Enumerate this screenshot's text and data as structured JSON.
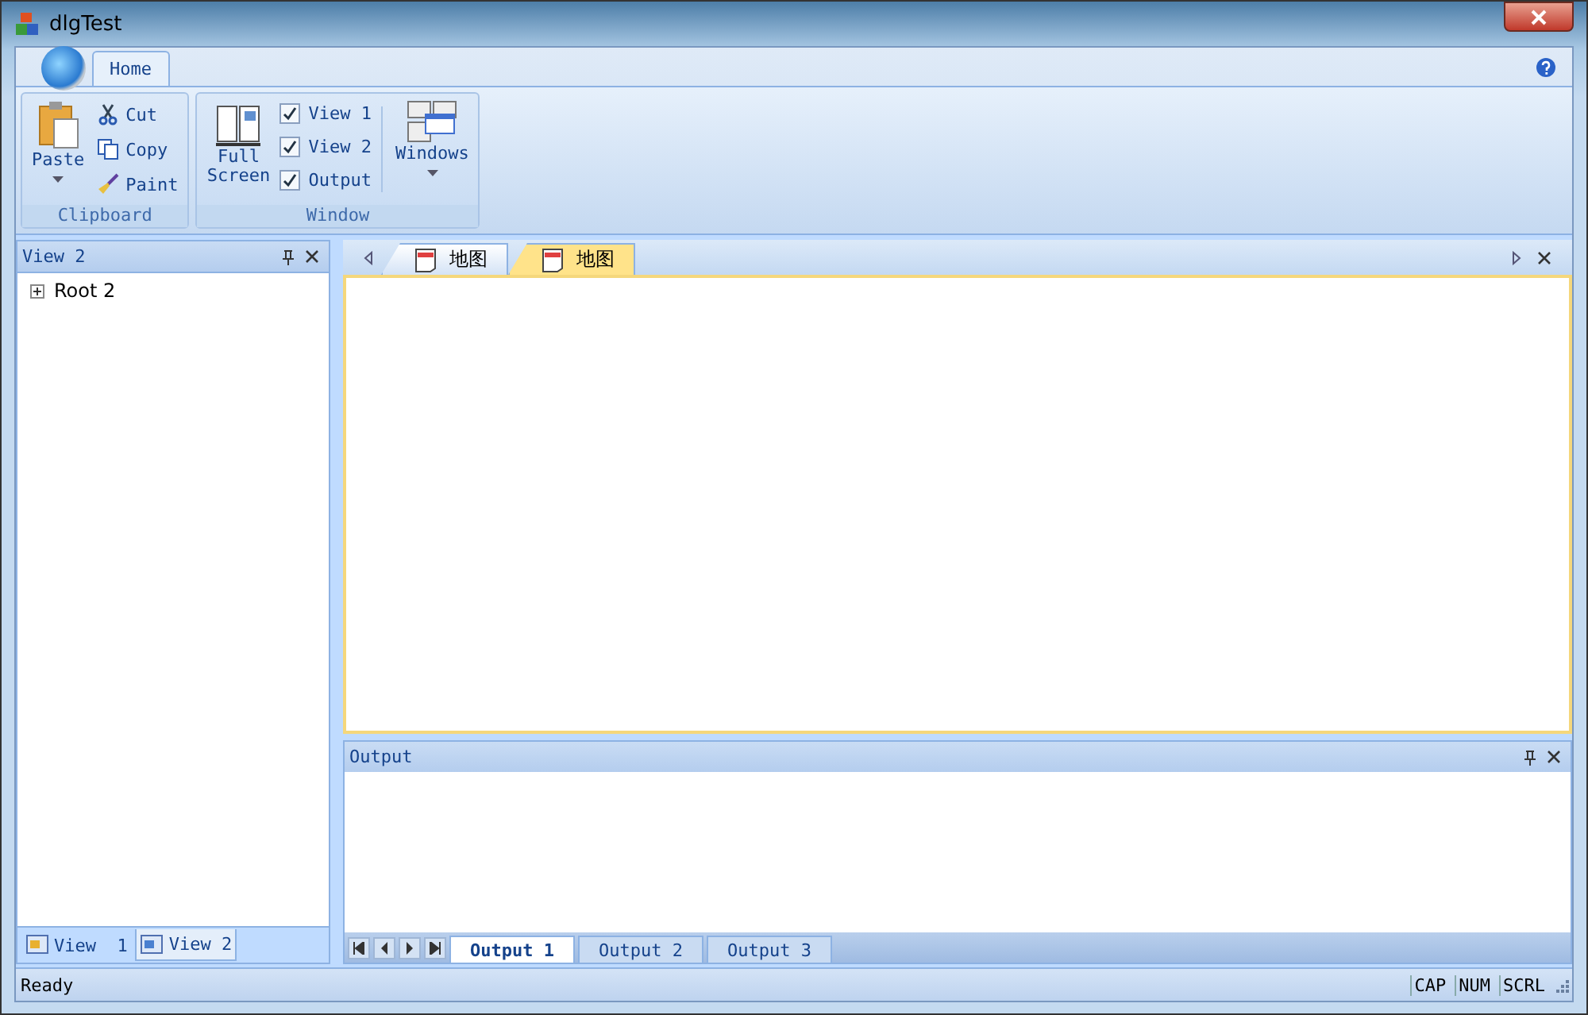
{
  "window": {
    "title": "dlgTest"
  },
  "ribbon": {
    "tabs": [
      {
        "label": "Home",
        "selected": true
      }
    ],
    "clipboard": {
      "label": "Clipboard",
      "paste": "Paste",
      "small": [
        {
          "kind": "cut",
          "label": "Cut"
        },
        {
          "kind": "copy",
          "label": "Copy"
        },
        {
          "kind": "paint",
          "label": "Paint"
        }
      ]
    },
    "window_group": {
      "label": "Window",
      "full_screen": "Full Screen",
      "checks": [
        {
          "label": "View 1",
          "checked": true
        },
        {
          "label": "View 2",
          "checked": true
        },
        {
          "label": "Output",
          "checked": true
        }
      ],
      "windows": "Windows"
    }
  },
  "left_pane": {
    "title": "View 2",
    "tree": [
      {
        "label": "Root 2",
        "expanded": false
      }
    ],
    "tabs": [
      {
        "label": "View  1",
        "selected": false
      },
      {
        "label": "View 2",
        "selected": true
      }
    ]
  },
  "documents": {
    "tabs": [
      {
        "label": "地图",
        "selected": false
      },
      {
        "label": "地图",
        "selected": true
      }
    ]
  },
  "output": {
    "title": "Output",
    "tabs": [
      {
        "label": "Output 1",
        "selected": true
      },
      {
        "label": "Output 2",
        "selected": false
      },
      {
        "label": "Output 3",
        "selected": false
      }
    ]
  },
  "status_bar": {
    "text": "Ready",
    "indicators": [
      "CAP",
      "NUM",
      "SCRL"
    ]
  }
}
